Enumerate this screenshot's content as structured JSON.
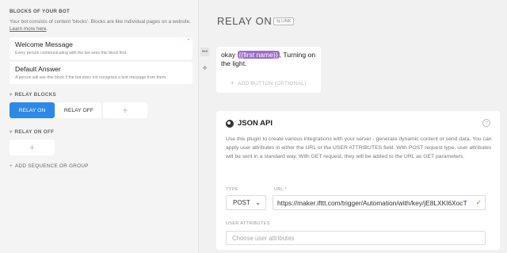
{
  "left": {
    "section_title": "BLOCKS OF YOUR BOT",
    "intro_text": "Your bot consists of content 'blocks'. Blocks are like individual pages on a website.",
    "intro_link": "Learn more here",
    "intro_end": ".",
    "cards": [
      {
        "title": "Welcome Message",
        "subtitle": "Every person communicating with the bot sees this block first.",
        "marker": "*"
      },
      {
        "title": "Default Answer",
        "subtitle": "A person will see this block if the bot does not recognize a text message from them."
      }
    ],
    "groups": [
      {
        "label": "RELAY BLOCKS",
        "chips": [
          "RELAY ON",
          "RELAY OFF",
          "+"
        ]
      },
      {
        "label": "RELAY ON OFF",
        "chips": [
          "+"
        ]
      }
    ],
    "add_sequence": "ADD SEQUENCE OR GROUP"
  },
  "block": {
    "title": "RELAY ON",
    "link_badge": "LINK",
    "text_before": "okay ",
    "attribute": "{{first name}}",
    "text_after": ", Turning on the light.",
    "add_button": "ADD BUTTON (OPTIONAL)"
  },
  "json_api": {
    "title": "JSON API",
    "description": "Use this plugin to create various integrations with your server - generate dynamic content or send data. You can apply user attributes in either the URL or the USER ATTRIBUTES field. With POST request type, user attributes will be sent in a standard way. With GET request, they will be added to the URL as GET parameters.",
    "type_label": "TYPE",
    "type_value": "POST",
    "url_label": "URL *",
    "url_value": "https://maker.ifttt.com/trigger/Automation/with/key/jE8LXKI6XocT",
    "user_attributes_label": "USER ATTRIBUTES",
    "user_attributes_placeholder": "Choose user attributes"
  },
  "colors": {
    "accent": "#2b89e8",
    "attribute_pill": "#9b6dc9",
    "valid_check": "#3aae53"
  },
  "icons": [
    "chevron-down-icon",
    "plus-icon",
    "link-icon",
    "more-icon",
    "move-icon",
    "json-api-icon",
    "help-icon",
    "check-icon"
  ]
}
